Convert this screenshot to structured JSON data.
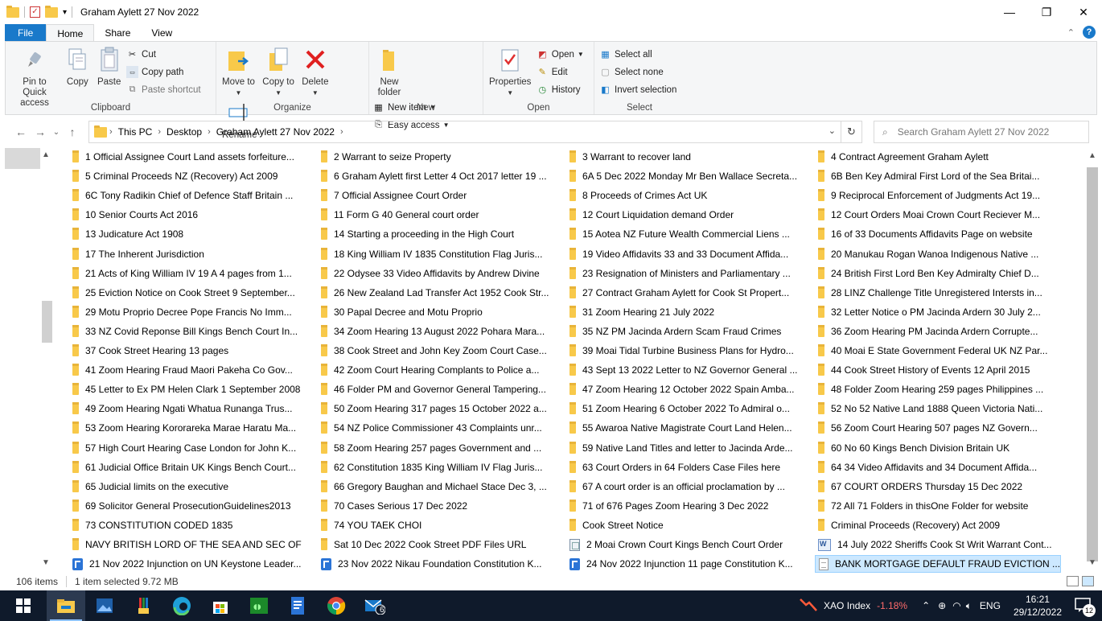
{
  "window": {
    "title": "Graham Aylett 27 Nov 2022",
    "controls": [
      "—",
      "❐",
      "✕"
    ]
  },
  "ribbon_tabs": {
    "file": "File",
    "home": "Home",
    "share": "Share",
    "view": "View",
    "help": "?"
  },
  "clipboard": {
    "pin_label": "Pin to Quick access",
    "copy_label": "Copy",
    "paste_label": "Paste",
    "cut_label": "Cut",
    "copy_path_label": "Copy path",
    "paste_shortcut_label": "Paste shortcut",
    "group_label": "Clipboard"
  },
  "organize": {
    "move_label": "Move to",
    "copy_to_label": "Copy to",
    "delete_label": "Delete",
    "rename_label": "Rename",
    "group_label": "Organize"
  },
  "new_grp": {
    "new_folder_label": "New folder",
    "new_item_label": "New item",
    "easy_access_label": "Easy access",
    "group_label": "New"
  },
  "open_grp": {
    "properties_label": "Properties",
    "open_label": "Open",
    "edit_label": "Edit",
    "history_label": "History",
    "group_label": "Open"
  },
  "select_grp": {
    "select_all_label": "Select all",
    "select_none_label": "Select none",
    "invert_label": "Invert selection",
    "group_label": "Select"
  },
  "address": {
    "crumbs": [
      "This PC",
      "Desktop",
      "Graham Aylett 27 Nov 2022"
    ],
    "search_placeholder": "Search Graham Aylett 27 Nov 2022"
  },
  "files": [
    {
      "name": "1 Official Assignee Court Land assets forfeiture...",
      "type": "folder"
    },
    {
      "name": "2 Warrant to seize Property",
      "type": "folder"
    },
    {
      "name": "3 Warrant to recover land",
      "type": "folder"
    },
    {
      "name": "4 Contract Agreement Graham Aylett",
      "type": "folder"
    },
    {
      "name": "5 Criminal Proceeds NZ (Recovery) Act 2009",
      "type": "folder"
    },
    {
      "name": "6 Graham Aylett first Letter 4 Oct 2017 letter 19 ...",
      "type": "folder"
    },
    {
      "name": "6A 5 Dec 2022 Monday Mr Ben Wallace Secreta...",
      "type": "folder"
    },
    {
      "name": "6B  Ben Key Admiral First Lord of the Sea Britai...",
      "type": "folder"
    },
    {
      "name": "6C Tony Radikin Chief of Defence Staff Britain ...",
      "type": "folder"
    },
    {
      "name": "7 Official Assignee Court Order",
      "type": "folder"
    },
    {
      "name": "8 Proceeds of Crimes Act UK",
      "type": "folder"
    },
    {
      "name": "9 Reciprocal Enforcement of Judgments Act 19...",
      "type": "folder"
    },
    {
      "name": "10 Senior Courts Act 2016",
      "type": "folder"
    },
    {
      "name": "11 Form G 40 General court order",
      "type": "folder"
    },
    {
      "name": "12 Court Liquidation demand Order",
      "type": "folder"
    },
    {
      "name": "12 Court Orders Moai Crown Court Reciever M...",
      "type": "folder"
    },
    {
      "name": "13 Judicature Act 1908",
      "type": "folder"
    },
    {
      "name": "14 Starting a proceeding in the High Court",
      "type": "folder"
    },
    {
      "name": "15 Aotea NZ Future Wealth Commercial Liens ...",
      "type": "folder"
    },
    {
      "name": "16  of 33 Documents Affidavits Page on website",
      "type": "folder"
    },
    {
      "name": "17 The Inherent Jurisdiction",
      "type": "folder"
    },
    {
      "name": "18 King William IV 1835 Constitution Flag Juris...",
      "type": "folder"
    },
    {
      "name": "19 Video Affidavits 33 and 33 Document Affida...",
      "type": "folder"
    },
    {
      "name": "20 Manukau Rogan Wanoa Indigenous Native ...",
      "type": "folder"
    },
    {
      "name": "21 Acts of King William IV 19 A 4 pages from 1...",
      "type": "folder"
    },
    {
      "name": "22 Odysee 33 Video Affidavits by Andrew Divine",
      "type": "folder"
    },
    {
      "name": "23 Resignation of Ministers and Parliamentary ...",
      "type": "folder"
    },
    {
      "name": "24 British First Lord Ben Key Admiralty Chief D...",
      "type": "folder"
    },
    {
      "name": "25 Eviction Notice on Cook Street 9 September...",
      "type": "folder"
    },
    {
      "name": "26 New Zealand Lad Transfer Act 1952 Cook Str...",
      "type": "folder"
    },
    {
      "name": "27 Contract Graham Aylett for Cook St Propert...",
      "type": "folder"
    },
    {
      "name": "28 LINZ Challenge Title Unregistered Intersts in...",
      "type": "folder"
    },
    {
      "name": "29 Motu Proprio Decree Pope Francis No Imm...",
      "type": "folder"
    },
    {
      "name": "30 Papal Decree and Motu Proprio",
      "type": "folder"
    },
    {
      "name": "31 Zoom Hearing 21 July 2022",
      "type": "folder"
    },
    {
      "name": "32 Letter Notice o PM Jacinda Ardern 30 July 2...",
      "type": "folder"
    },
    {
      "name": "33 NZ Covid Reponse Bill Kings Bench Court In...",
      "type": "folder"
    },
    {
      "name": "34 Zoom Hearing 13 August 2022 Pohara Mara...",
      "type": "folder"
    },
    {
      "name": "35 NZ PM Jacinda Ardern Scam Fraud Crimes",
      "type": "folder"
    },
    {
      "name": "36 Zoom Hearing PM Jacinda Ardern Corrupte...",
      "type": "folder"
    },
    {
      "name": "37 Cook Street Hearing 13 pages",
      "type": "folder"
    },
    {
      "name": "38 Cook Street and John Key Zoom Court Case...",
      "type": "folder"
    },
    {
      "name": "39 Moai Tidal Turbine Business Plans for Hydro...",
      "type": "folder"
    },
    {
      "name": "40 Moai E State Government Federal UK NZ Par...",
      "type": "folder"
    },
    {
      "name": "41 Zoom Hearing Fraud Maori Pakeha Co Gov...",
      "type": "folder"
    },
    {
      "name": "42 Zoom Court Hearing Complants to Police a...",
      "type": "folder"
    },
    {
      "name": "43 Sept 13 2022 Letter to NZ Governor General ...",
      "type": "folder"
    },
    {
      "name": "44 Cook Street History of Events 12 April 2015",
      "type": "folder"
    },
    {
      "name": "45 Letter to Ex PM Helen Clark 1 September 2008",
      "type": "folder"
    },
    {
      "name": "46 Folder PM and Governor General Tampering...",
      "type": "folder"
    },
    {
      "name": "47 Zoom Hearing 12 October 2022 Spain Amba...",
      "type": "folder"
    },
    {
      "name": "48 Folder Zoom Hearing 259 pages Philippines ...",
      "type": "folder"
    },
    {
      "name": "49  Zoom Hearing Ngati Whatua Runanga Trus...",
      "type": "folder"
    },
    {
      "name": "50 Zoom Hearing 317 pages 15 October 2022 a...",
      "type": "folder"
    },
    {
      "name": "51 Zoom Hearing 6 October 2022 To Admiral o...",
      "type": "folder"
    },
    {
      "name": "52 No 52 Native Land 1888 Queen Victoria Nati...",
      "type": "folder"
    },
    {
      "name": "53 Zoom Hearing Kororareka Marae Haratu Ma...",
      "type": "folder"
    },
    {
      "name": "54 NZ Police Commissioner 43 Complaints unr...",
      "type": "folder"
    },
    {
      "name": "55 Awaroa Native Magistrate Court Land Helen...",
      "type": "folder"
    },
    {
      "name": "56  Zoom Court Hearing 507 pages NZ Govern...",
      "type": "folder"
    },
    {
      "name": "57 High Court Hearing Case London for John K...",
      "type": "folder"
    },
    {
      "name": "58 Zoom Hearing 257 pages Government and ...",
      "type": "folder"
    },
    {
      "name": "59 Native Land Titles and letter to Jacinda Arde...",
      "type": "folder"
    },
    {
      "name": "60 No 60 Kings Bench Division Britain UK",
      "type": "folder"
    },
    {
      "name": "61 Judicial Office Britain UK Kings Bench Court...",
      "type": "folder"
    },
    {
      "name": "62 Constitution 1835 King William IV Flag Juris...",
      "type": "folder"
    },
    {
      "name": "63 Court Orders in 64 Folders Case Files here",
      "type": "folder"
    },
    {
      "name": "64 34 Video Affidavits and 34 Document Affida...",
      "type": "folder"
    },
    {
      "name": "65 Judicial limits on the executive",
      "type": "folder"
    },
    {
      "name": "66 Gregory Baughan and Michael Stace Dec 3, ...",
      "type": "folder"
    },
    {
      "name": "67 A court order is an official proclamation by ...",
      "type": "folder"
    },
    {
      "name": "67 COURT ORDERS Thursday 15 Dec 2022",
      "type": "folder"
    },
    {
      "name": "69 Solicitor General ProsecutionGuidelines2013",
      "type": "folder"
    },
    {
      "name": "70 Cases Serious 17 Dec 2022",
      "type": "folder"
    },
    {
      "name": "71 of 676 Pages Zoom Hearing 3 Dec 2022",
      "type": "folder"
    },
    {
      "name": "72 All 71 Folders in thisOne Folder for website",
      "type": "folder"
    },
    {
      "name": "73 CONSTITUTION CODED 1835",
      "type": "folder"
    },
    {
      "name": "74 YOU TAEK CHOI",
      "type": "folder"
    },
    {
      "name": "Cook Street Notice",
      "type": "folder"
    },
    {
      "name": "Criminal Proceeds (Recovery) Act 2009",
      "type": "folder"
    },
    {
      "name": "NAVY BRITISH LORD OF THE SEA AND SEC OF ...",
      "type": "folder"
    },
    {
      "name": "Sat 10 Dec 2022 Cook Street PDF Files URL",
      "type": "folder"
    },
    {
      "name": "2 Moai Crown Court Kings Bench Court Order",
      "type": "sheet"
    },
    {
      "name": "14 July 2022 Sheriffs Cook St Writ Warrant Cont...",
      "type": "word"
    },
    {
      "name": "21 Nov 2022 Injunction on UN Keystone Leader...",
      "type": "pdf"
    },
    {
      "name": "23 Nov 2022 Nikau Foundation Constitution K...",
      "type": "pdf"
    },
    {
      "name": "24 Nov 2022 Injunction 11 page Constitution K...",
      "type": "pdf"
    },
    {
      "name": "BANK MORTGAGE DEFAULT FRAUD EVICTION ...",
      "type": "doc",
      "selected": true
    }
  ],
  "status": {
    "count": "106 items",
    "selected": "1 item selected  9.72 MB"
  },
  "taskbar": {
    "index_name": "XAO Index",
    "index_change": "-1.18%",
    "lang": "ENG",
    "time": "16:21",
    "date": "29/12/2022",
    "notif_count": "12",
    "mail_badge": "6"
  }
}
